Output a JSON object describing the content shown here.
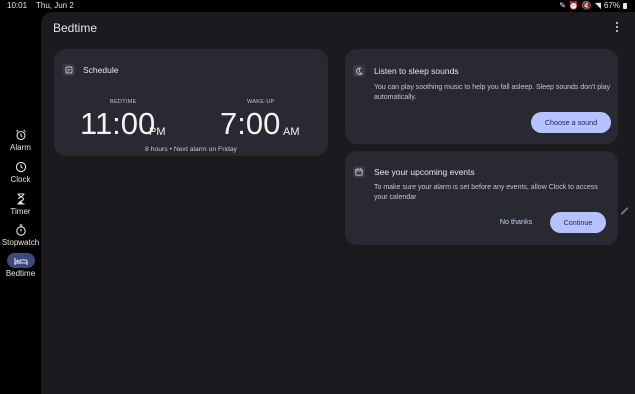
{
  "status_bar": {
    "time": "10:01",
    "date": "Thu, Jun 2",
    "icons": [
      "edit-icon",
      "alarm-icon",
      "mute-icon",
      "wifi-icon"
    ],
    "battery": "67%"
  },
  "nav": {
    "items": [
      {
        "label": "Alarm",
        "icon": "alarm-icon",
        "glyph": "⏰",
        "active": false
      },
      {
        "label": "Clock",
        "icon": "clock-icon",
        "glyph": "🕒",
        "active": false
      },
      {
        "label": "Timer",
        "icon": "hourglass-icon",
        "glyph": "⌛",
        "active": false
      },
      {
        "label": "Stopwatch",
        "icon": "stopwatch-icon",
        "glyph": "⏱",
        "active": false
      },
      {
        "label": "Bedtime",
        "icon": "bed-icon",
        "glyph": "🛏",
        "active": true
      }
    ]
  },
  "page": {
    "title": "Bedtime"
  },
  "schedule": {
    "title": "Schedule",
    "bedtime_label": "BEDTIME",
    "bedtime_time": "11:00",
    "bedtime_ampm": "PM",
    "wakeup_label": "WAKE-UP",
    "wakeup_time": "7:00",
    "wakeup_ampm": "AM",
    "footer": "8 hours • Next alarm on Friday"
  },
  "sleep_sounds": {
    "title": "Listen to sleep sounds",
    "body": "You can play soothing music to help you fall asleep. Sleep sounds don't play automatically.",
    "button": "Choose a sound"
  },
  "events": {
    "title": "See your upcoming events",
    "body": "To make sure your alarm is set before any events, allow Clock to access your calendar",
    "dismiss": "No thanks",
    "confirm": "Continue"
  },
  "colors": {
    "background": "#000000",
    "panel": "#1b1b1f",
    "card": "#292a31",
    "accent": "#b5c2ff",
    "active_nav": "#3e4a7a"
  }
}
